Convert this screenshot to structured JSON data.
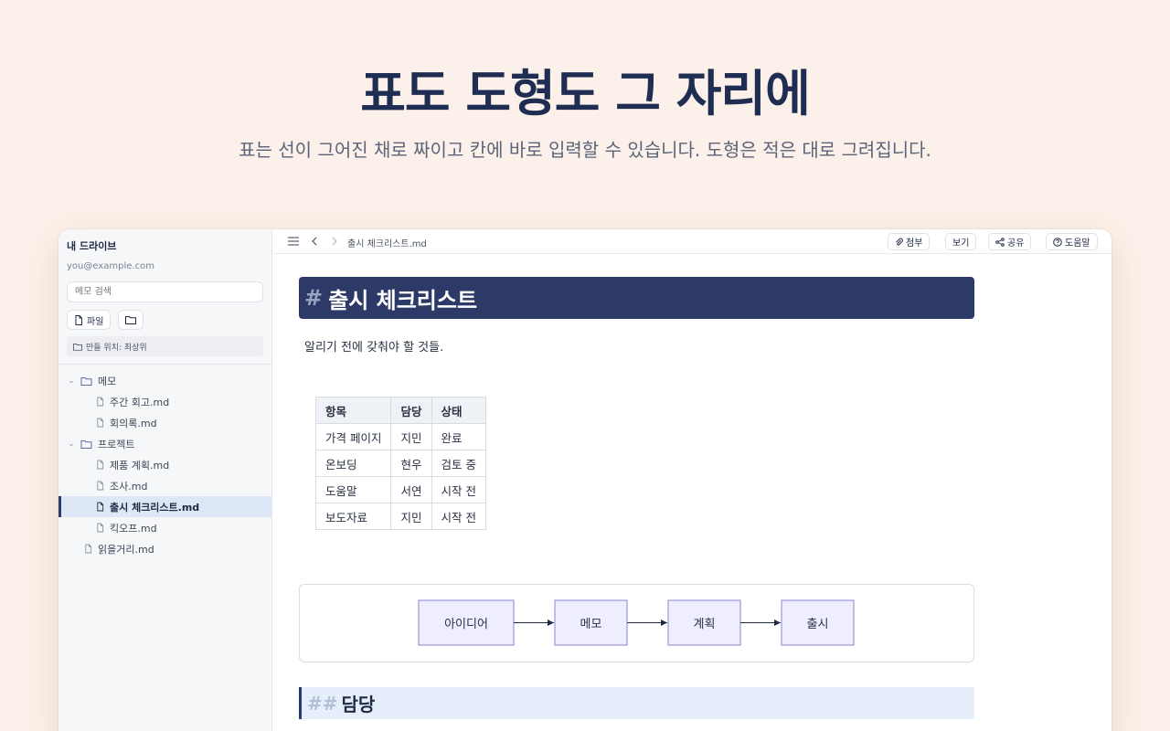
{
  "hero": {
    "title": "표도 도형도 그 자리에",
    "subtitle": "표는 선이 그어진 채로 짜이고 칸에 바로 입력할 수 있습니다. 도형은 적은 대로 그려집니다."
  },
  "sidebar": {
    "title": "내 드라이브",
    "email": "you@example.com",
    "search_placeholder": "메모 검색",
    "new_file_label": "파일",
    "location_label": "만들 위치: 최상위",
    "tree": [
      {
        "label": "메모",
        "type": "folder",
        "expanded": true
      },
      {
        "label": "주간 회고.md",
        "type": "file"
      },
      {
        "label": "회의록.md",
        "type": "file"
      },
      {
        "label": "프로젝트",
        "type": "folder",
        "expanded": true
      },
      {
        "label": "제품 계획.md",
        "type": "file"
      },
      {
        "label": "조사.md",
        "type": "file"
      },
      {
        "label": "출시 체크리스트.md",
        "type": "file",
        "active": true
      },
      {
        "label": "킥오프.md",
        "type": "file"
      },
      {
        "label": "읽을거리.md",
        "type": "file"
      }
    ]
  },
  "topbar": {
    "breadcrumb": "출시 체크리스트.md",
    "attach_label": "첨부",
    "view_label": "보기",
    "share_label": "공유",
    "help_label": "도움말"
  },
  "document": {
    "h1_hash": "#",
    "h1_text": "출시 체크리스트",
    "intro": "알리기 전에 갖춰야 할 것들.",
    "table": {
      "headers": [
        "항목",
        "담당",
        "상태"
      ],
      "rows": [
        [
          "가격 페이지",
          "지민",
          "완료"
        ],
        [
          "온보딩",
          "현우",
          "검토 중"
        ],
        [
          "도움말",
          "서연",
          "시작 전"
        ],
        [
          "보도자료",
          "지민",
          "시작 전"
        ]
      ]
    },
    "flow": [
      "아이디어",
      "메모",
      "계획",
      "출시"
    ],
    "h2_hash": "##",
    "h2_text": "담당"
  },
  "colors": {
    "accent": "#2d3a68",
    "flow_fill": "#eeeefe",
    "flow_stroke": "#8b84d4"
  }
}
